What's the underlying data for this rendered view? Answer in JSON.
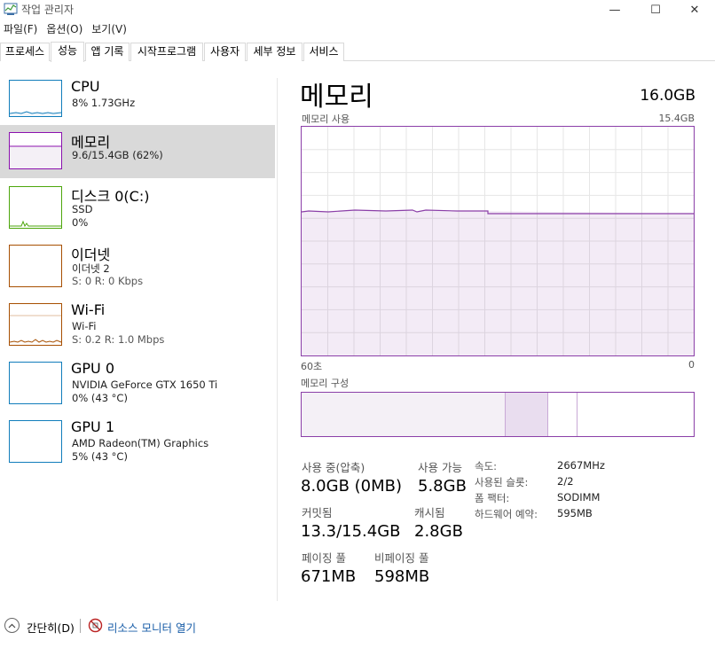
{
  "window": {
    "title": "작업 관리자",
    "minimize": "—",
    "maximize": "☐",
    "close": "✕"
  },
  "menu": {
    "items": [
      "파일(F)",
      "옵션(O)",
      "보기(V)"
    ]
  },
  "tabs": [
    {
      "label": "프로세스",
      "active": false
    },
    {
      "label": "성능",
      "active": true
    },
    {
      "label": "앱 기록",
      "active": false
    },
    {
      "label": "시작프로그램",
      "active": false
    },
    {
      "label": "사용자",
      "active": false
    },
    {
      "label": "세부 정보",
      "active": false
    },
    {
      "label": "서비스",
      "active": false
    }
  ],
  "devices": [
    {
      "title": "CPU",
      "sub1": "8% 1.73GHz",
      "sub2": "",
      "color": "#117dbb"
    },
    {
      "title": "메모리",
      "sub1": "9.6/15.4GB (62%)",
      "sub2": "",
      "color": "#8b12ae"
    },
    {
      "title": "디스크 0(C:)",
      "sub1": "SSD",
      "sub2": "0%",
      "color": "#4da60c"
    },
    {
      "title": "이더넷",
      "sub1": "이더넷 2",
      "sub2": "S:  0  R:  0 Kbps",
      "color": "#a74f01"
    },
    {
      "title": "Wi-Fi",
      "sub1": "Wi-Fi",
      "sub2": "S:  0.2  R:  1.0 Mbps",
      "color": "#a74f01"
    },
    {
      "title": "GPU 0",
      "sub1": "NVIDIA GeForce GTX 1650 Ti",
      "sub2": "0% (43 °C)",
      "color": "#117dbb"
    },
    {
      "title": "GPU 1",
      "sub1": "AMD Radeon(TM) Graphics",
      "sub2": "5% (43 °C)",
      "color": "#117dbb"
    }
  ],
  "memory": {
    "title": "메모리",
    "total": "16.0GB",
    "usage_label": "메모리 사용",
    "usage_max": "15.4GB",
    "time_left": "60초",
    "time_right": "0",
    "composition_label": "메모리 구성",
    "usage_fraction": 0.62,
    "stats": {
      "in_use_label": "사용 중(압축)",
      "in_use_value": "8.0GB (0MB)",
      "available_label": "사용 가능",
      "available_value": "5.8GB",
      "committed_label": "커밋됨",
      "committed_value": "13.3/15.4GB",
      "cached_label": "캐시됨",
      "cached_value": "2.8GB",
      "paged_label": "페이징 풀",
      "paged_value": "671MB",
      "nonpaged_label": "비페이징 풀",
      "nonpaged_value": "598MB"
    },
    "details": {
      "speed_label": "속도:",
      "speed_value": "2667MHz",
      "slots_label": "사용된 슬롯:",
      "slots_value": "2/2",
      "form_label": "폼 팩터:",
      "form_value": "SODIMM",
      "reserved_label": "하드웨어 예약:",
      "reserved_value": "595MB"
    }
  },
  "footer": {
    "collapse": "간단히(D)",
    "resmon": "리소스 모니터 열기"
  },
  "colors": {
    "memory_accent": "#8b3fa8",
    "memory_fill": "#f4f0f6",
    "selected_bg": "#d9d9d9",
    "link": "#1a5ea8"
  }
}
